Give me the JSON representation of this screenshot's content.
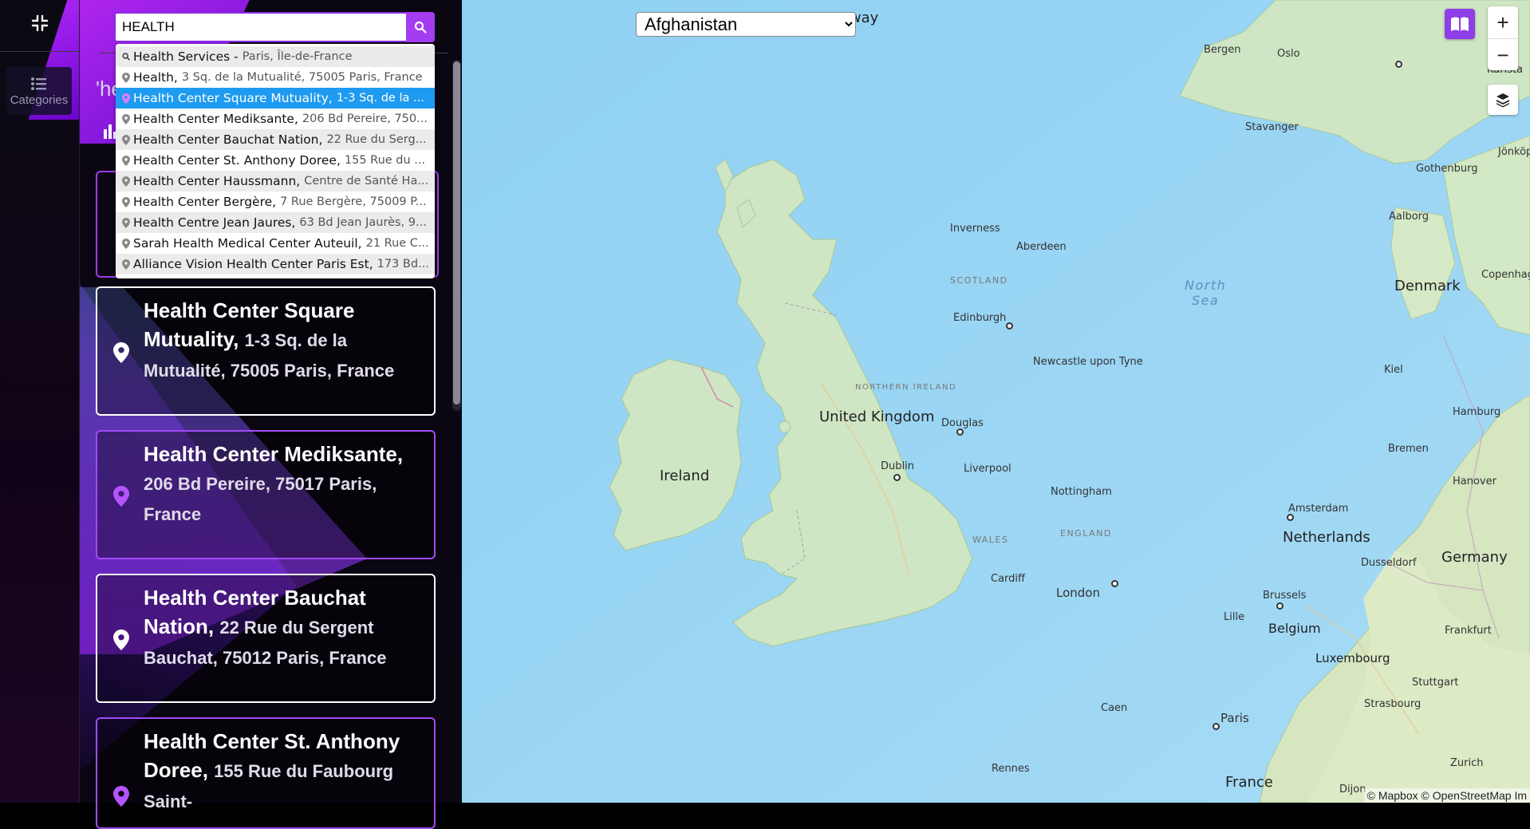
{
  "rail": {
    "categories_label": "Categories"
  },
  "search": {
    "value": "HEALTH",
    "placeholder": ""
  },
  "suggestions": [
    {
      "name": "Health Services - ",
      "addr": "Paris, Île-de-France",
      "kind": "search"
    },
    {
      "name": "Health,",
      "addr": "3 Sq. de la Mutualité, 75005 Paris, France",
      "kind": "place"
    },
    {
      "name": "Health Center Square Mutuality,",
      "addr": "1-3 Sq. de la ...",
      "kind": "place"
    },
    {
      "name": "Health Center Mediksante,",
      "addr": "206 Bd Pereire, 750...",
      "kind": "place"
    },
    {
      "name": "Health Center Bauchat Nation,",
      "addr": "22 Rue du Serg...",
      "kind": "place"
    },
    {
      "name": "Health Center St. Anthony Doree,",
      "addr": "155 Rue du ...",
      "kind": "place"
    },
    {
      "name": "Health Center Haussmann,",
      "addr": "Centre de Santé Ha...",
      "kind": "place"
    },
    {
      "name": "Health Center Bergère,",
      "addr": "7 Rue Bergère, 75009 P...",
      "kind": "place"
    },
    {
      "name": "Health Centre Jean Jaures,",
      "addr": "63 Bd Jean Jaurès, 9...",
      "kind": "place"
    },
    {
      "name": "Sarah Health Medical Center Auteuil,",
      "addr": "21 Rue C...",
      "kind": "place"
    },
    {
      "name": "Alliance Vision Health Center Paris Est,",
      "addr": "173 Bd...",
      "kind": "place"
    }
  ],
  "results_heading": "'he",
  "results": [
    {
      "name": "Health Center Square Mutuality,",
      "addr": "1-3 Sq. de la Mutualité, 75005 Paris, France"
    },
    {
      "name": "Health Center Mediksante,",
      "addr": "206 Bd Pereire, 75017 Paris, France"
    },
    {
      "name": "Health Center Bauchat Nation,",
      "addr": "22 Rue du Sergent Bauchat, 75012 Paris, France"
    },
    {
      "name": "Health Center St. Anthony Doree,",
      "addr": "155 Rue du Faubourg Saint-"
    }
  ],
  "map": {
    "country_select": "Afghanistan",
    "countries": [
      "Ireland",
      "United Kingdom",
      "Denmark",
      "Netherlands",
      "Germany",
      "Belgium",
      "Luxembourg",
      "France",
      "Norway"
    ],
    "regions": [
      "SCOTLAND",
      "NORTHERN IRELAND",
      "WALES",
      "ENGLAND"
    ],
    "sea": [
      "North",
      "Sea"
    ],
    "cities": [
      "Bergen",
      "Oslo",
      "Karlsta",
      "Stavanger",
      "Jönköpi",
      "Gothenburg",
      "Aalborg",
      "Copenhage",
      "Inverness",
      "Aberdeen",
      "Edinburgh",
      "Newcastle upon Tyne",
      "Douglas",
      "Dublin",
      "Liverpool",
      "Nottingham",
      "Cardiff",
      "London",
      "Kiel",
      "Hamburg",
      "Bremen",
      "Hanover",
      "Amsterdam",
      "Dusseldorf",
      "Brussels",
      "Lille",
      "Frankfurt",
      "Stuttgart",
      "Strasbourg",
      "Caen",
      "Paris",
      "Rennes",
      "Zurich",
      "Dijon"
    ],
    "zoom_in": "+",
    "zoom_out": "−",
    "attribution": "© Mapbox © OpenStreetMap Im"
  },
  "colors": {
    "accent": "#a43cf0",
    "highlight": "#1e9bf0",
    "water": "#8fcef0",
    "land": "#cfe6c4"
  }
}
